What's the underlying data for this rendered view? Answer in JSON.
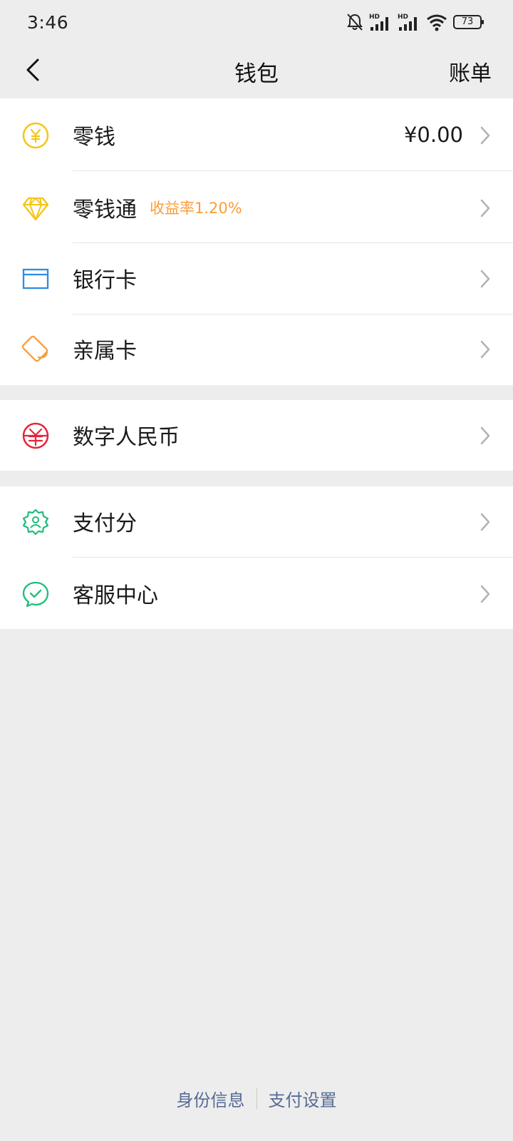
{
  "status_bar": {
    "time": "3:46",
    "battery": "73",
    "icons": [
      "bell-muted-icon",
      "hd-signal-icon",
      "hd-signal-icon",
      "wifi-icon",
      "battery-icon"
    ]
  },
  "header": {
    "back_icon": "chevron-left-icon",
    "title": "钱包",
    "bill_label": "账单"
  },
  "sections": [
    {
      "items": [
        {
          "id": "change",
          "label": "零钱",
          "value": "¥0.00",
          "icon": "yuan-coin-icon",
          "icon_color": "#f5c518"
        },
        {
          "id": "change-pass",
          "label": "零钱通",
          "badge": "收益率1.20%",
          "icon": "diamond-icon",
          "icon_color": "#f5c518"
        },
        {
          "id": "bank-card",
          "label": "银行卡",
          "icon": "bank-card-icon",
          "icon_color": "#2f8de0"
        },
        {
          "id": "family-card",
          "label": "亲属卡",
          "icon": "family-card-icon",
          "icon_color": "#fa9d3b"
        }
      ]
    },
    {
      "items": [
        {
          "id": "digital-rmb",
          "label": "数字人民币",
          "icon": "digital-rmb-icon",
          "icon_color": "#e6243c"
        }
      ]
    },
    {
      "items": [
        {
          "id": "pay-score",
          "label": "支付分",
          "icon": "pay-score-icon",
          "icon_color": "#1ebe78"
        },
        {
          "id": "customer-service",
          "label": "客服中心",
          "icon": "customer-service-icon",
          "icon_color": "#1ebe78"
        }
      ]
    }
  ],
  "footer": {
    "identity_label": "身份信息",
    "pay_settings_label": "支付设置",
    "link_color": "#576b95"
  },
  "colors": {
    "background": "#ededed",
    "accent_orange": "#fa9d3b"
  }
}
